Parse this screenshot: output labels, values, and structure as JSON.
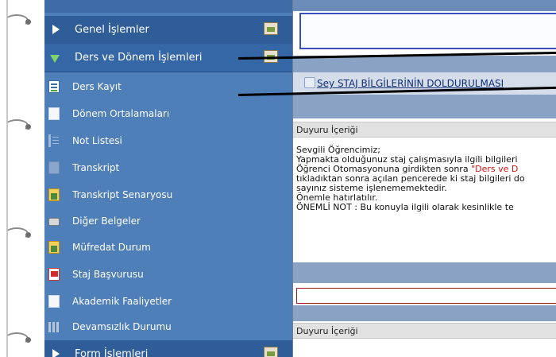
{
  "menu": {
    "headers": [
      {
        "label": "Genel İşlemler",
        "state": "collapsed",
        "icon": "home-icon"
      },
      {
        "label": "Ders ve Dönem İşlemleri",
        "state": "expanded",
        "icon": "folder-icon"
      },
      {
        "label": "Form İşlemleri",
        "state": "collapsed",
        "icon": "form-icon"
      }
    ],
    "items": [
      {
        "label": "Ders Kayıt",
        "icon": "form-edit-icon"
      },
      {
        "label": "Dönem Ortalamaları",
        "icon": "document-icon"
      },
      {
        "label": "Not Listesi",
        "icon": "list-icon"
      },
      {
        "label": "Transkript",
        "icon": "transcript-icon"
      },
      {
        "label": "Transkript Senaryosu",
        "icon": "chart-icon"
      },
      {
        "label": "Diğer Belgeler",
        "icon": "printer-icon"
      },
      {
        "label": "Müfredat Durum",
        "icon": "chart-icon"
      },
      {
        "label": "Staj Başvurusu",
        "icon": "flag-icon"
      },
      {
        "label": "Akademik Faaliyetler",
        "icon": "document-icon"
      },
      {
        "label": "Devamsızlık Durumu",
        "icon": "bars-icon"
      }
    ]
  },
  "content": {
    "announcement_title": "STAJ BİLGİLERİNİN DOLDURULMASI",
    "announcement_link_prefix": "Sey",
    "section_label": "Duyuru İçeriği",
    "body_lines": [
      "Sevgili Öğrencimiz;",
      "Yapmakta olduğunuz staj çalışmasıyla ilgili bilgileri",
      "Öğrenci Otomasyonuna girdikten sonra ",
      "tıkladıktan sonra açılan pencerede ki staj bilgileri do",
      "sayınız sisteme işlenememektedir.",
      "Önemle hatırlatılır.",
      "ÖNEMLİ NOT : Bu konuyla ilgili olarak kesinlikle te"
    ],
    "body_highlight": "\"Ders ve D",
    "section_label_2": "Duyuru İçeriği"
  },
  "colors": {
    "menu_bg": "#4f7fb8",
    "header_bg": "#2f5d98",
    "link": "#0f2f74",
    "highlight": "#d01515"
  }
}
